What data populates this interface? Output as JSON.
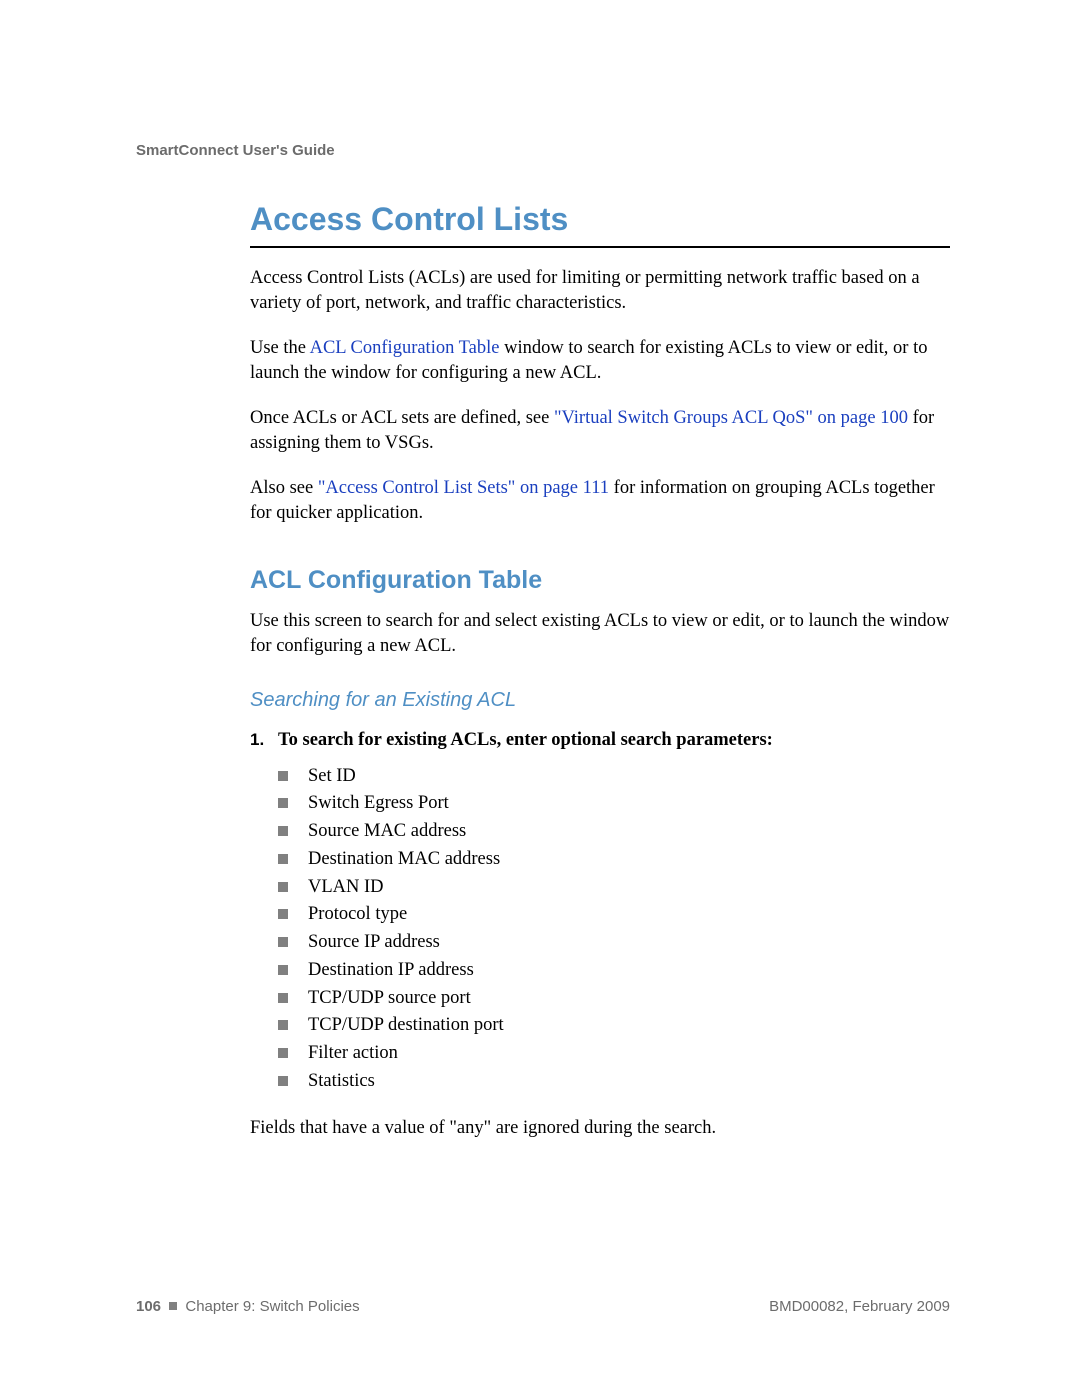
{
  "header": {
    "title": "SmartConnect User's Guide"
  },
  "main": {
    "title": "Access Control Lists",
    "intro": "Access Control Lists (ACLs) are used for limiting or permitting network traffic based on a variety of port, network, and traffic characteristics.",
    "use_pre": "Use the ",
    "use_link": "ACL Configuration Table",
    "use_post": " window to search for existing ACLs to view or edit, or to launch the window for configuring a new ACL.",
    "once_pre": "Once ACLs or ACL sets are defined, see ",
    "once_link": "\"Virtual Switch Groups ACL QoS\" on page 100",
    "once_post": " for assigning them to VSGs.",
    "also_pre": "Also see ",
    "also_link": "\"Access Control List Sets\" on page 111",
    "also_post": " for information on grouping ACLs together for quicker application.",
    "section_title": "ACL Configuration Table",
    "section_body": "Use this screen to search for and select existing ACLs to view or edit, or to launch the window for configuring a new ACL.",
    "subsection_title": "Searching for an Existing ACL",
    "step_num": "1.",
    "step_text": "To search for existing ACLs, enter optional search parameters:",
    "bullets": [
      "Set ID",
      "Switch Egress Port",
      "Source MAC address",
      "Destination MAC address",
      "VLAN ID",
      "Protocol type",
      "Source IP address",
      "Destination IP address",
      "TCP/UDP source port",
      "TCP/UDP destination port",
      "Filter action",
      "Statistics"
    ],
    "note": "Fields that have a value of \"any\" are ignored during the search."
  },
  "footer": {
    "page_number": "106",
    "chapter": "Chapter 9: Switch Policies",
    "doc_id": "BMD00082, February 2009"
  }
}
